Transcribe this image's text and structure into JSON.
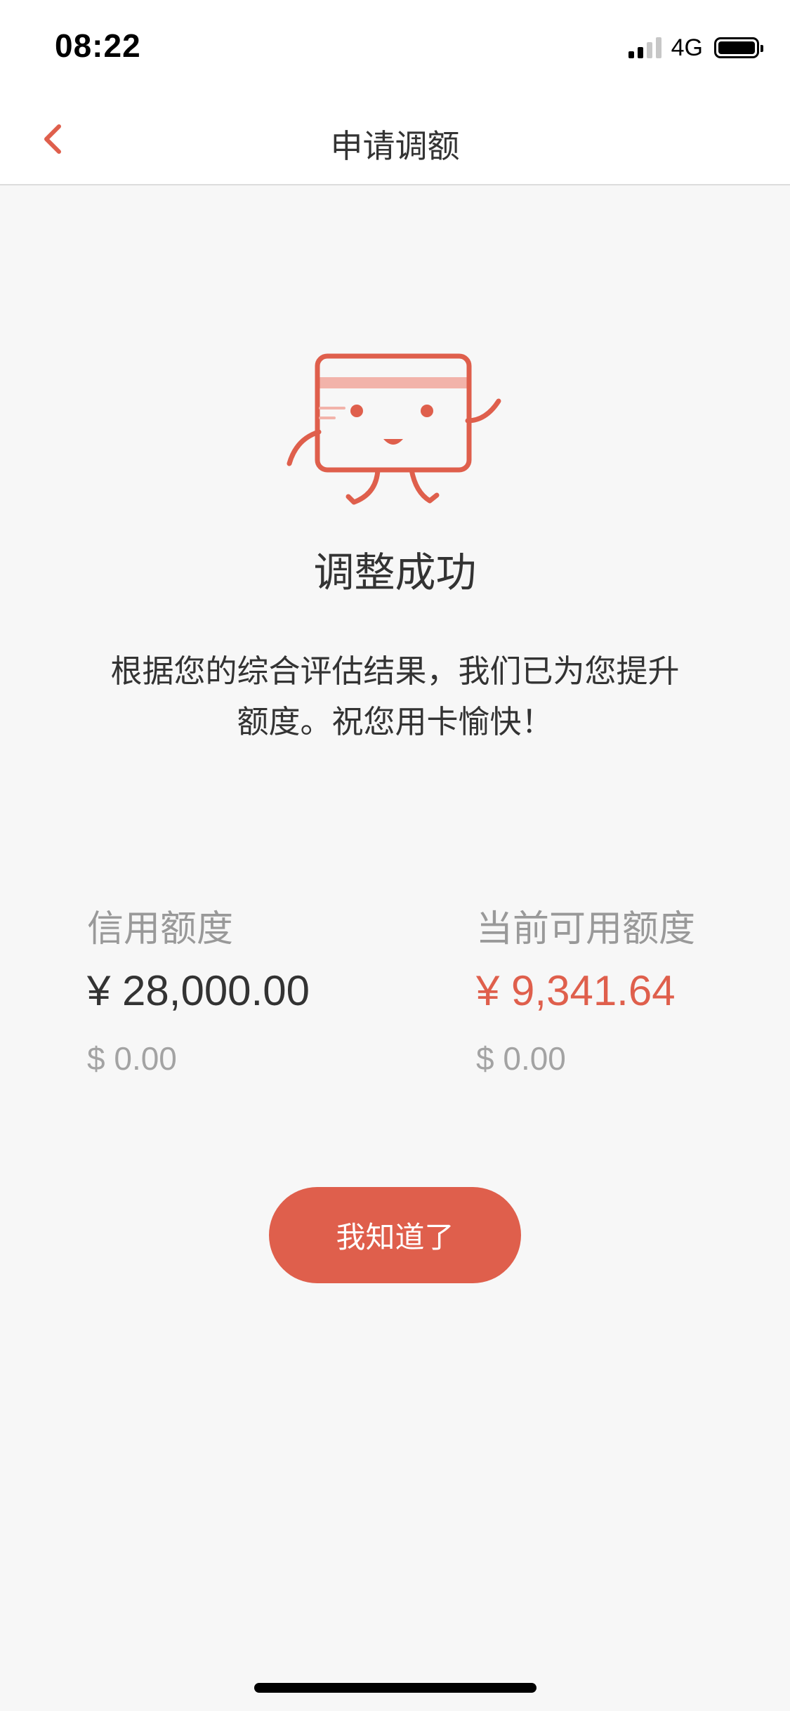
{
  "status_bar": {
    "time": "08:22",
    "network": "4G",
    "battery_level": 1.0
  },
  "nav": {
    "title": "申请调额",
    "back_icon": "chevron-left-icon"
  },
  "mascot": {
    "icon": "smiling-credit-card-mascot-icon"
  },
  "result": {
    "title": "调整成功",
    "description_line1": "根据您的综合评估结果，我们已为您提升",
    "description_line2": "额度。祝您用卡愉快！"
  },
  "credit_limit": {
    "label": "信用额度",
    "cny": "¥ 28,000.00",
    "usd": "$ 0.00"
  },
  "available_limit": {
    "label": "当前可用额度",
    "cny": "¥ 9,341.64",
    "usd": "$ 0.00"
  },
  "button": {
    "label": "我知道了"
  },
  "colors": {
    "accent": "#df5f4c",
    "accent_light": "#f2b3aa",
    "text_primary": "#333333",
    "text_secondary": "#999999",
    "background": "#f7f7f7"
  }
}
